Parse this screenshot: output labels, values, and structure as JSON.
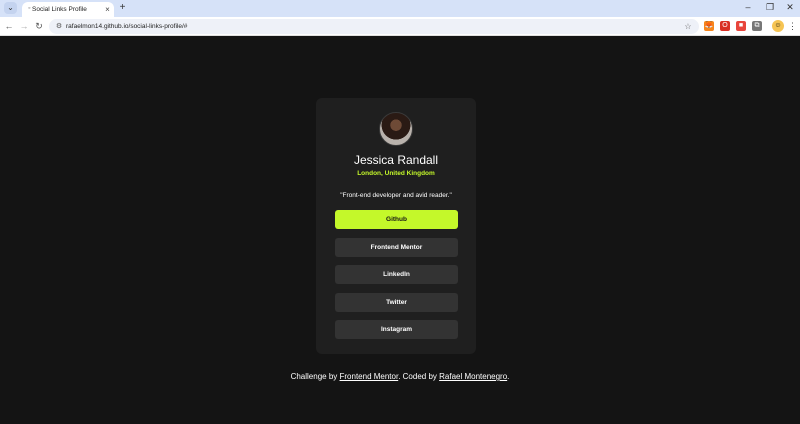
{
  "browser": {
    "tab_list_glyph": "⌄",
    "tab": {
      "favicon": "◦",
      "title": "Social Links Profile",
      "close": "×"
    },
    "new_tab": "+",
    "window_controls": {
      "minimize": "–",
      "maximize": "❐",
      "close": "✕"
    },
    "nav": {
      "back": "←",
      "forward": "→",
      "reload": "↻"
    },
    "url": "rafaelmon14.github.io/social-links-profile/#",
    "site_info_glyph": "⚙",
    "star_glyph": "☆",
    "menu_glyph": "⋮",
    "extensions": [
      {
        "name": "metamask-icon",
        "glyph": "🦊",
        "color": "#f6851b"
      },
      {
        "name": "opera-icon",
        "glyph": "O",
        "color": "#d93025"
      },
      {
        "name": "red-extension-icon",
        "glyph": "■",
        "color": "#e8453c"
      },
      {
        "name": "extensions-puzzle-icon",
        "glyph": "⧉",
        "color": "#777777"
      }
    ],
    "profile_glyph": "☺"
  },
  "profile": {
    "name": "Jessica Randall",
    "location": "London, United Kingdom",
    "bio": "\"Front-end developer and avid reader.\"",
    "links": [
      {
        "label": "Github"
      },
      {
        "label": "Frontend Mentor"
      },
      {
        "label": "LinkedIn"
      },
      {
        "label": "Twitter"
      },
      {
        "label": "Instagram"
      }
    ]
  },
  "footer": {
    "prefix": "Challenge by ",
    "challenge_link": "Frontend Mentor",
    "middle": ". Coded by ",
    "author_link": "Rafael Montenegro",
    "suffix": "."
  },
  "colors": {
    "page_bg": "#141414",
    "card_bg": "#1f1f1f",
    "button_bg": "#333333",
    "accent": "#c4f82a"
  }
}
